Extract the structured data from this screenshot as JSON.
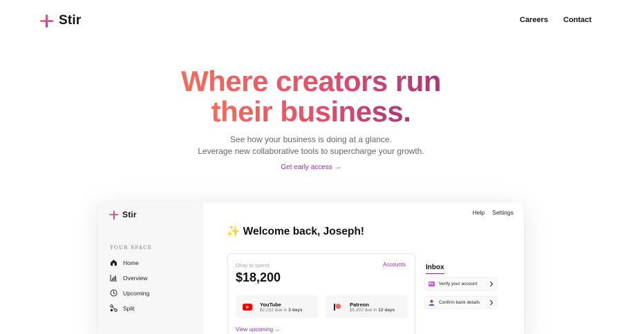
{
  "nav": {
    "brand": "Stir",
    "links": [
      {
        "label": "Careers"
      },
      {
        "label": "Contact"
      }
    ]
  },
  "hero": {
    "headline_line1": "Where creators run",
    "headline_line2": "their business.",
    "subtitle_line1": "See how your business is doing at a glance.",
    "subtitle_line2": "Leverage new collaborative tools to supercharge your growth.",
    "cta_label": "Get early access →"
  },
  "colors": {
    "accent": "#8a2fa8",
    "gradient_start": "#f36c5c",
    "gradient_end": "#a8387a",
    "youtube_red": "#ff0000",
    "patreon_coral": "#f96854"
  },
  "app": {
    "brand": "Stir",
    "sidebar": {
      "section_title": "YOUR SPACE",
      "items": [
        {
          "label": "Home",
          "icon": "home-icon"
        },
        {
          "label": "Overview",
          "icon": "chart-icon"
        },
        {
          "label": "Upcoming",
          "icon": "clock-icon"
        },
        {
          "label": "Split",
          "icon": "split-icon"
        }
      ]
    },
    "top_links": [
      {
        "label": "Help"
      },
      {
        "label": "Settings"
      }
    ],
    "welcome_emoji": "✨",
    "welcome": "Welcome back, Joseph!",
    "spend_card": {
      "label": "Okay to spend",
      "accounts_link": "Accounts",
      "amount": "$18,200",
      "accounts": [
        {
          "name": "YouTube",
          "due_prefix": "$2,232 due in ",
          "due_days": "3 days",
          "icon": "youtube-icon"
        },
        {
          "name": "Patreon",
          "due_prefix": "$5,302 due in ",
          "due_days": "12 days",
          "icon": "patreon-icon"
        }
      ],
      "view_upcoming": "View upcoming →"
    },
    "inbox": {
      "title": "Inbox",
      "items": [
        {
          "label": "Verify your account",
          "icon": "id-card-icon"
        },
        {
          "label": "Confirm bank details",
          "icon": "user-icon"
        }
      ]
    }
  }
}
